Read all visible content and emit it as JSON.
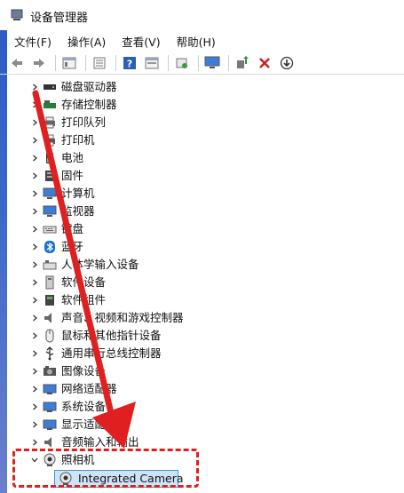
{
  "window": {
    "title": "设备管理器"
  },
  "menu": {
    "items": [
      "文件(F)",
      "操作(A)",
      "查看(V)",
      "帮助(H)"
    ]
  },
  "toolbar": {
    "icons": [
      "back-icon",
      "forward-icon",
      "properties-icon",
      "driver-icon",
      "help-icon",
      "view-icon",
      "scan-icon",
      "monitor-icon",
      "update-driver-icon",
      "uninstall-icon",
      "disable-icon"
    ]
  },
  "tree": {
    "categories": [
      {
        "label": "磁盘驱动器",
        "icon": "disk-icon",
        "expanded": false
      },
      {
        "label": "存储控制器",
        "icon": "storage-controller-icon",
        "expanded": false
      },
      {
        "label": "打印队列",
        "icon": "print-queue-icon",
        "expanded": false
      },
      {
        "label": "打印机",
        "icon": "printer-icon",
        "expanded": false
      },
      {
        "label": "电池",
        "icon": "battery-icon",
        "expanded": false
      },
      {
        "label": "固件",
        "icon": "firmware-icon",
        "expanded": false
      },
      {
        "label": "计算机",
        "icon": "computer-icon",
        "expanded": false
      },
      {
        "label": "监视器",
        "icon": "monitor-icon",
        "expanded": false
      },
      {
        "label": "键盘",
        "icon": "keyboard-icon",
        "expanded": false
      },
      {
        "label": "蓝牙",
        "icon": "bluetooth-icon",
        "expanded": false
      },
      {
        "label": "人体学输入设备",
        "icon": "hid-icon",
        "expanded": false
      },
      {
        "label": "软件设备",
        "icon": "software-device-icon",
        "expanded": false
      },
      {
        "label": "软件组件",
        "icon": "software-component-icon",
        "expanded": false
      },
      {
        "label": "声音、视频和游戏控制器",
        "icon": "sound-icon",
        "expanded": false
      },
      {
        "label": "鼠标和其他指针设备",
        "icon": "mouse-icon",
        "expanded": false
      },
      {
        "label": "通用串行总线控制器",
        "icon": "usb-icon",
        "expanded": false
      },
      {
        "label": "图像设备",
        "icon": "imaging-icon",
        "expanded": false
      },
      {
        "label": "网络适配器",
        "icon": "network-icon",
        "expanded": false
      },
      {
        "label": "系统设备",
        "icon": "system-device-icon",
        "expanded": false
      },
      {
        "label": "显示适配器",
        "icon": "display-adapter-icon",
        "expanded": false
      },
      {
        "label": "音频输入和输出",
        "icon": "audio-io-icon",
        "expanded": false
      },
      {
        "label": "照相机",
        "icon": "camera-icon",
        "expanded": true
      }
    ],
    "camera_child": {
      "label": "Integrated Camera",
      "icon": "webcam-icon"
    }
  },
  "annotation": {
    "arrow_color": "#e02020",
    "box_color": "#e02020"
  }
}
